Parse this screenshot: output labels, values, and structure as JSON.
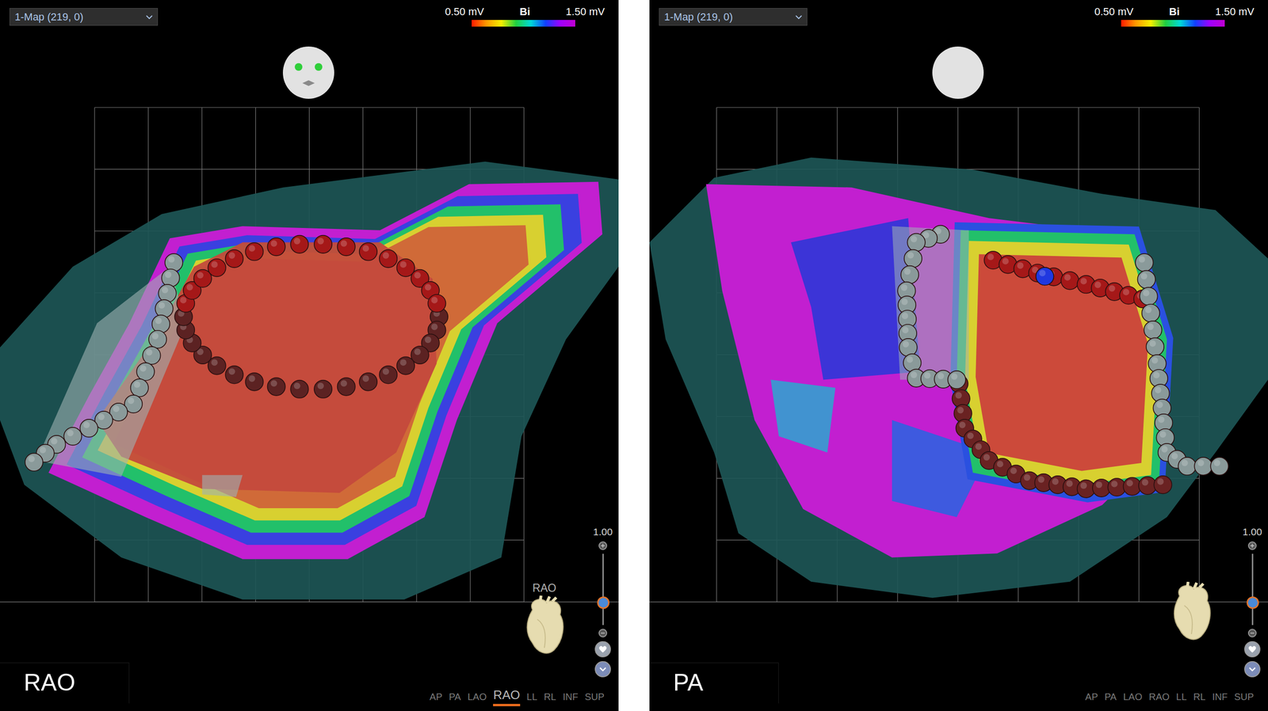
{
  "panels": [
    {
      "map_selector": {
        "value": "1-Map (219, 0)"
      },
      "scale": {
        "min": "0.50 mV",
        "label": "Bi",
        "max": "1.50 mV"
      },
      "head_view": {
        "kind": "front"
      },
      "orientation_label": "RAO",
      "zoom": {
        "value": "1.00",
        "level": 0.32
      },
      "view_buttons": [
        {
          "label": "AP",
          "selected": false
        },
        {
          "label": "PA",
          "selected": false
        },
        {
          "label": "LAO",
          "selected": false
        },
        {
          "label": "RAO",
          "selected": true
        },
        {
          "label": "LL",
          "selected": false
        },
        {
          "label": "RL",
          "selected": false
        },
        {
          "label": "INF",
          "selected": false
        },
        {
          "label": "SUP",
          "selected": false
        }
      ],
      "view_label": "RAO"
    },
    {
      "map_selector": {
        "value": "1-Map (219, 0)"
      },
      "scale": {
        "min": "0.50 mV",
        "label": "Bi",
        "max": "1.50 mV"
      },
      "head_view": {
        "kind": "back"
      },
      "zoom": {
        "value": "1.00",
        "level": 0.32
      },
      "view_buttons": [
        {
          "label": "AP",
          "selected": false
        },
        {
          "label": "PA",
          "selected": false
        },
        {
          "label": "LAO",
          "selected": false
        },
        {
          "label": "RAO",
          "selected": false
        },
        {
          "label": "LL",
          "selected": false
        },
        {
          "label": "RL",
          "selected": false
        },
        {
          "label": "INF",
          "selected": false
        },
        {
          "label": "SUP",
          "selected": false
        }
      ],
      "view_label": "PA"
    }
  ]
}
